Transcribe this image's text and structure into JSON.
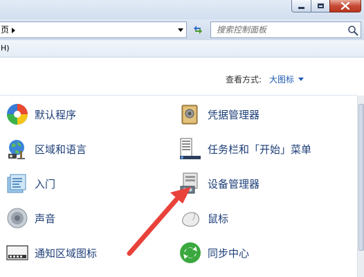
{
  "window": {
    "controls": {
      "minimize": "minimize-icon",
      "maximize": "maximize-icon",
      "close": "close-icon"
    }
  },
  "address": {
    "crumb": "页",
    "search_placeholder": "搜索控制面板"
  },
  "menu": {
    "fragment": "H)"
  },
  "view": {
    "label": "查看方式:",
    "value": "大图标"
  },
  "items_left": [
    {
      "label": "默认程序",
      "icon": "default-programs-icon"
    },
    {
      "label": "区域和语言",
      "icon": "region-language-icon"
    },
    {
      "label": "入门",
      "icon": "getting-started-icon"
    },
    {
      "label": "声音",
      "icon": "sound-icon"
    },
    {
      "label": "通知区域图标",
      "icon": "notification-icons-icon"
    }
  ],
  "items_right": [
    {
      "label": "凭据管理器",
      "icon": "credential-manager-icon"
    },
    {
      "label": "任务栏和「开始」菜单",
      "icon": "taskbar-start-menu-icon"
    },
    {
      "label": "设备管理器",
      "icon": "device-manager-icon"
    },
    {
      "label": "鼠标",
      "icon": "mouse-icon"
    },
    {
      "label": "同步中心",
      "icon": "sync-center-icon"
    }
  ],
  "colors": {
    "link": "#1e3f78",
    "accent": "#1e5bb0",
    "annotation_arrow": "#e8423a"
  }
}
